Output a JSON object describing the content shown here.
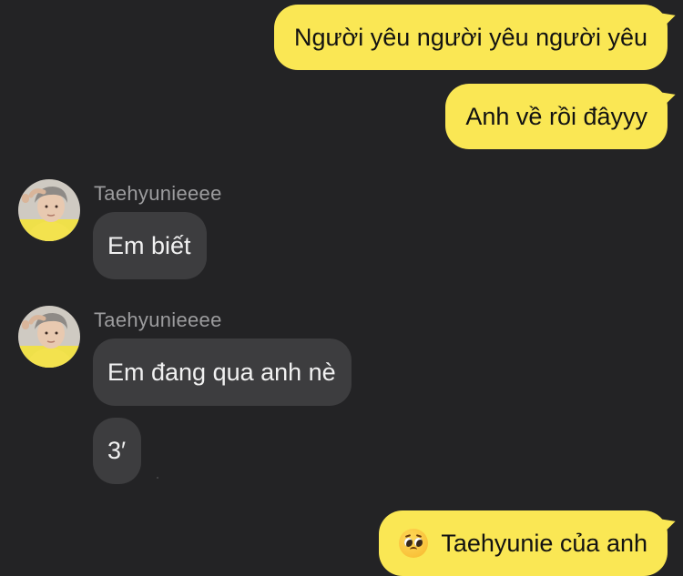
{
  "chat": {
    "sent_messages": [
      "Người yêu người yêu người yêu",
      "Anh về rồi đâyyy"
    ],
    "contact_name": "Taehyunieeee",
    "received_group_1": [
      "Em biết"
    ],
    "received_group_2": [
      "Em đang qua anh nè",
      "3′"
    ],
    "last_sent": {
      "emoji": "pleading-face-emoji",
      "text": "Taehyunie của anh"
    }
  },
  "colors": {
    "background": "#232325",
    "sent_bubble": "#fae754",
    "received_bubble": "#3d3d3f",
    "sender_name": "#9c9c9e"
  }
}
